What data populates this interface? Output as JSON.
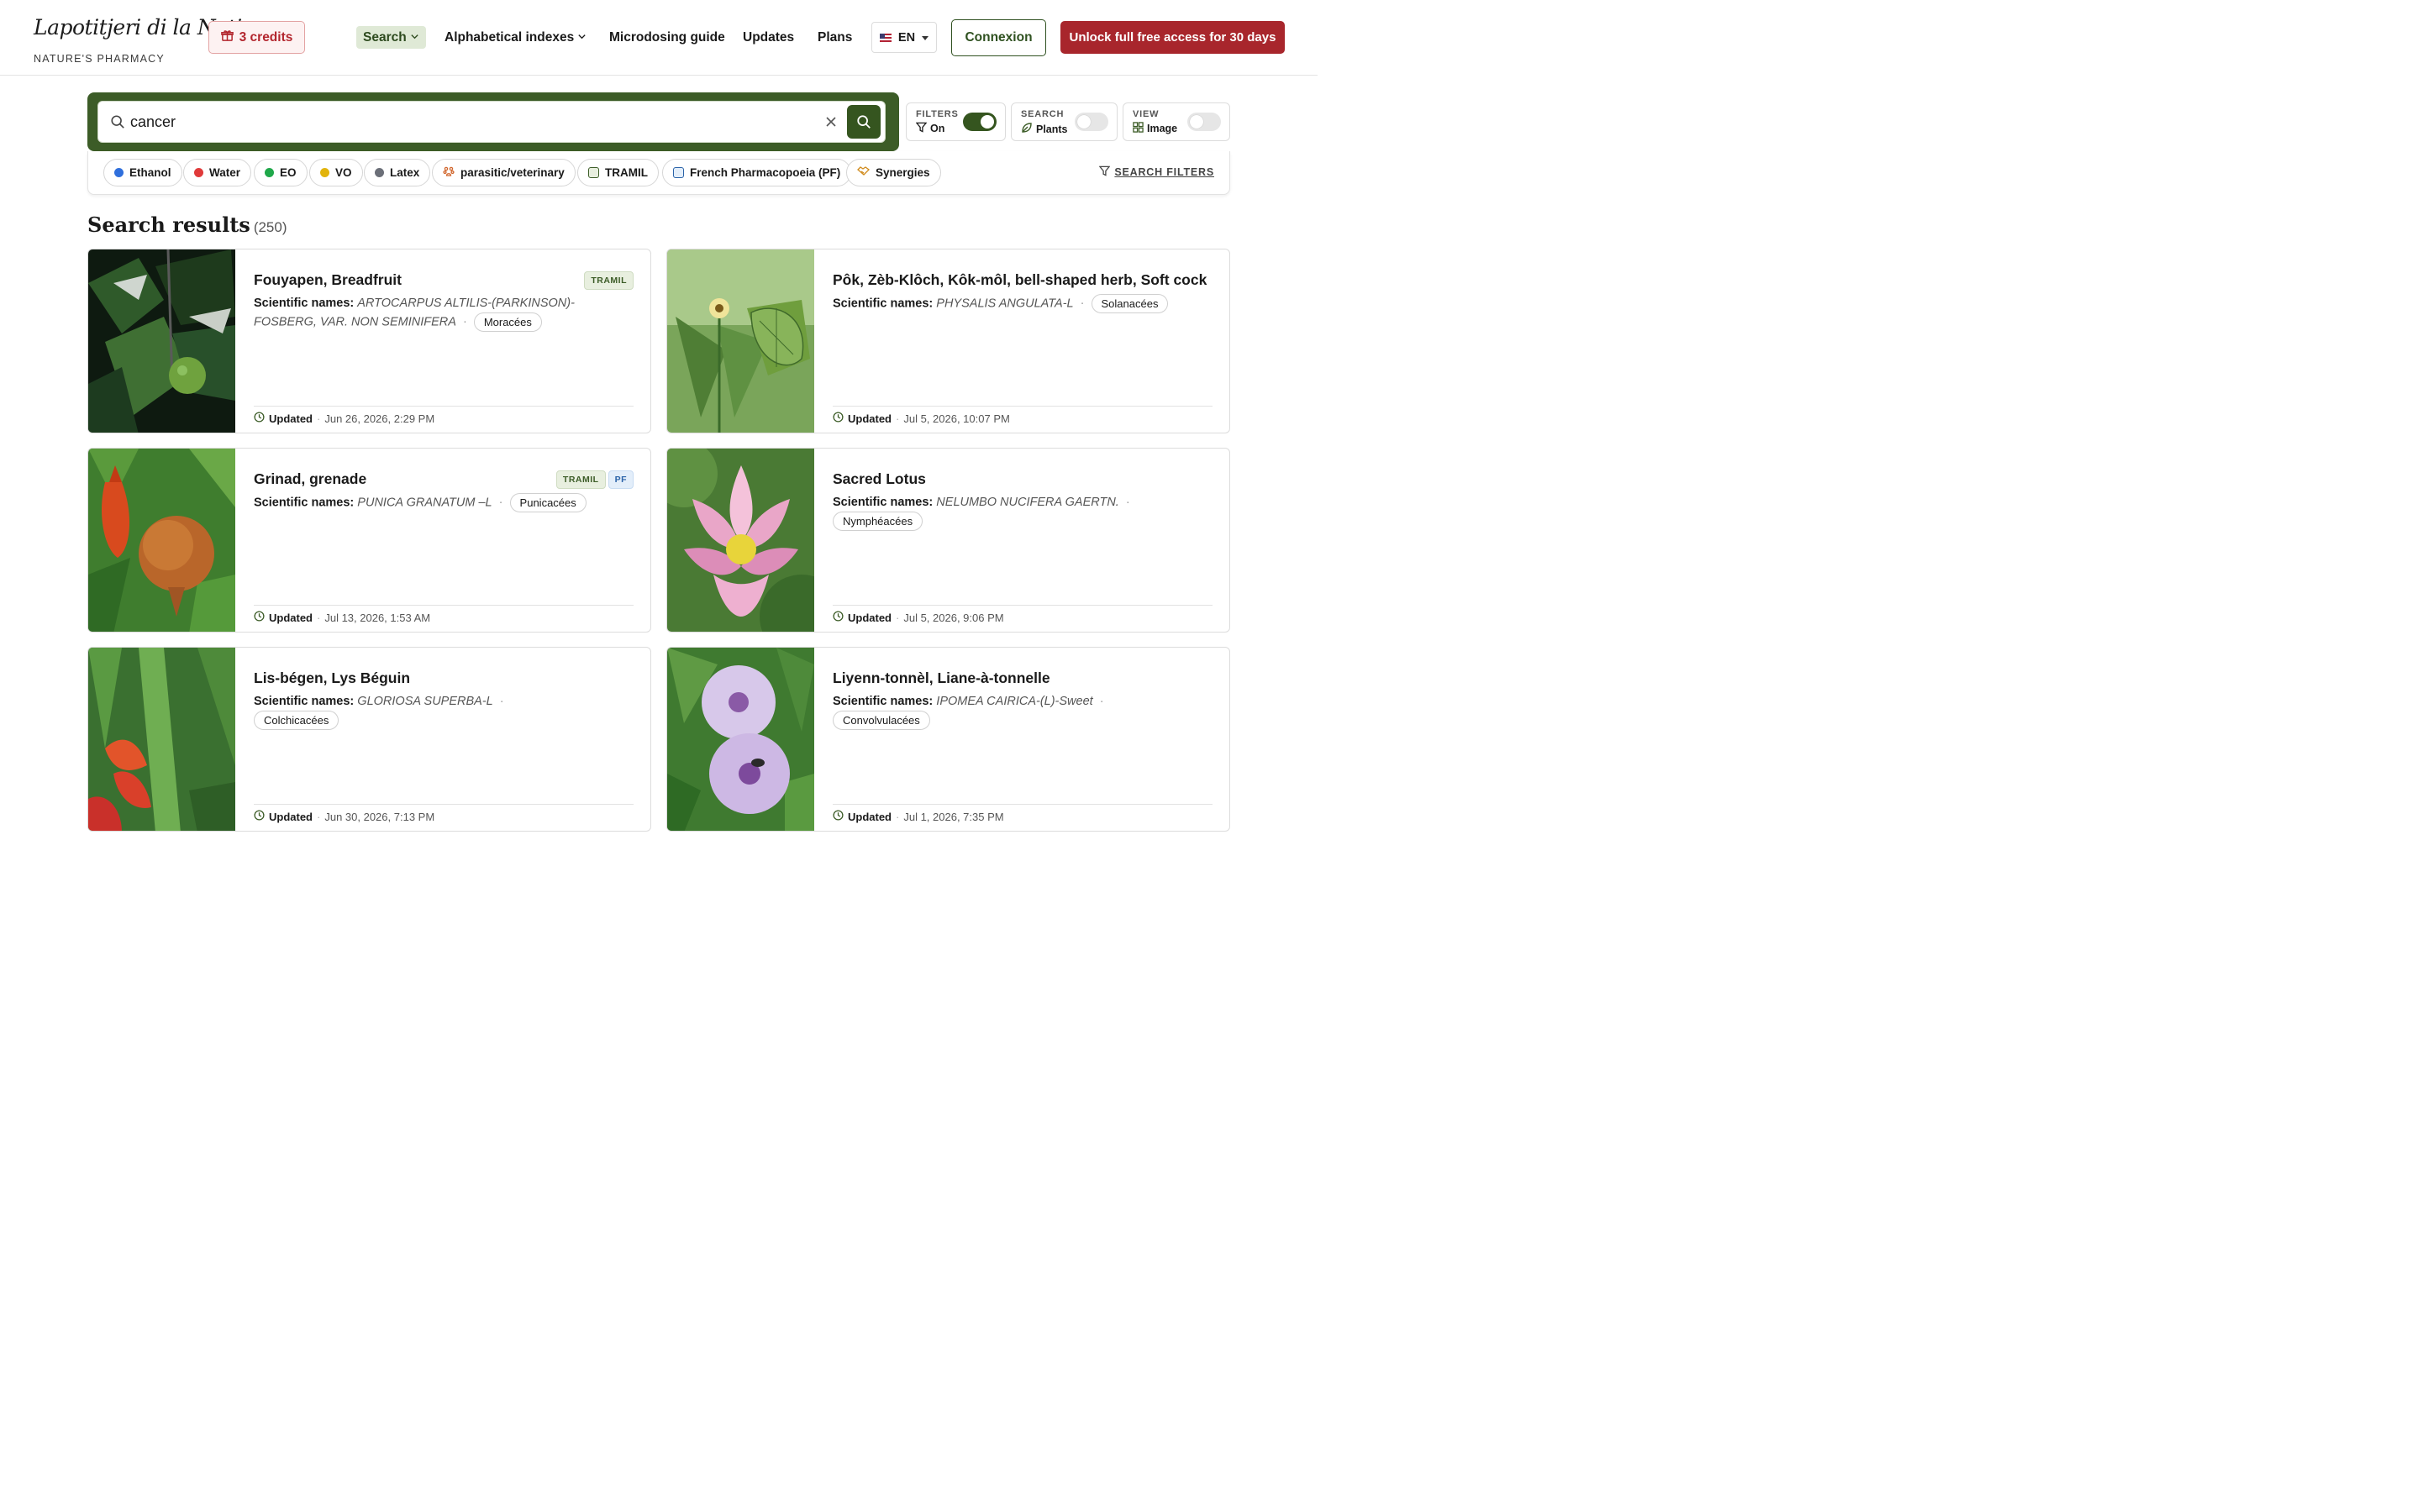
{
  "header": {
    "logo_title": "Lapotitjeri di la Nati",
    "logo_subtitle": "NATURE'S PHARMACY",
    "credits_label": "3 credits",
    "nav": {
      "search": "Search",
      "alphabetical": "Alphabetical indexes",
      "microdosing": "Microdosing guide",
      "updates": "Updates",
      "plans": "Plans"
    },
    "language": "EN",
    "connect_label": "Connexion",
    "unlock_label": "Unlock full free access for 30 days"
  },
  "search": {
    "value": "cancer"
  },
  "toggles": {
    "filters": {
      "label": "FILTERS",
      "value": "On",
      "state": "on"
    },
    "search_mode": {
      "label": "SEARCH",
      "value": "Plants",
      "state": "off"
    },
    "view": {
      "label": "VIEW",
      "value": "Image",
      "state": "off"
    }
  },
  "filter_chips": [
    {
      "label": "Ethanol",
      "color": "#2f6fdc"
    },
    {
      "label": "Water",
      "color": "#e03a3a"
    },
    {
      "label": "EO",
      "color": "#1fa84a"
    },
    {
      "label": "VO",
      "color": "#e2b40c"
    },
    {
      "label": "Latex",
      "color": "#6b6f78"
    },
    {
      "label": "parasitic/veterinary",
      "color": "#d0642a"
    },
    {
      "label": "TRAMIL",
      "color": "#3c5c27"
    },
    {
      "label": "French Pharmacopoeia (PF)",
      "color": "#2a63a8"
    },
    {
      "label": "Synergies",
      "color": "#d08a1a"
    }
  ],
  "search_filters_label": "SEARCH FILTERS",
  "results": {
    "title": "Search results",
    "count": "(250)",
    "sci_label": "Scientific names:",
    "updated_label": "Updated",
    "items": [
      {
        "title": "Fouyapen, Breadfruit",
        "scientific": "ARTOCARPUS ALTILIS-(PARKINSON)-FOSBERG, VAR. NON SEMINIFERA",
        "family": "Moracées",
        "badges": [
          "TRAMIL"
        ],
        "updated": "Jun 26, 2026, 2:29 PM"
      },
      {
        "title": "Pôk, Zèb-Klôch, Kôk-môl, bell-shaped herb, Soft cock",
        "scientific": "PHYSALIS ANGULATA-L",
        "family": "Solanacées",
        "badges": [],
        "updated": "Jul 5, 2026, 10:07 PM"
      },
      {
        "title": "Grinad, grenade",
        "scientific": "PUNICA GRANATUM –L",
        "family": "Punicacées",
        "badges": [
          "TRAMIL",
          "PF"
        ],
        "updated": "Jul 13, 2026, 1:53 AM"
      },
      {
        "title": "Sacred Lotus",
        "scientific": "NELUMBO NUCIFERA GAERTN.",
        "family": "Nymphéacées",
        "badges": [],
        "updated": "Jul 5, 2026, 9:06 PM"
      },
      {
        "title": "Lis-bégen, Lys Béguin",
        "scientific": "GLORIOSA SUPERBA-L",
        "family": "Colchicacées",
        "badges": [],
        "updated": "Jun 30, 2026, 7:13 PM"
      },
      {
        "title": "Liyenn-tonnèl, Liane-à-tonnelle",
        "scientific": "IPOMEA CAIRICA-(L)-Sweet",
        "family": "Convolvulacées",
        "badges": [],
        "updated": "Jul 1, 2026, 7:35 PM"
      }
    ]
  }
}
